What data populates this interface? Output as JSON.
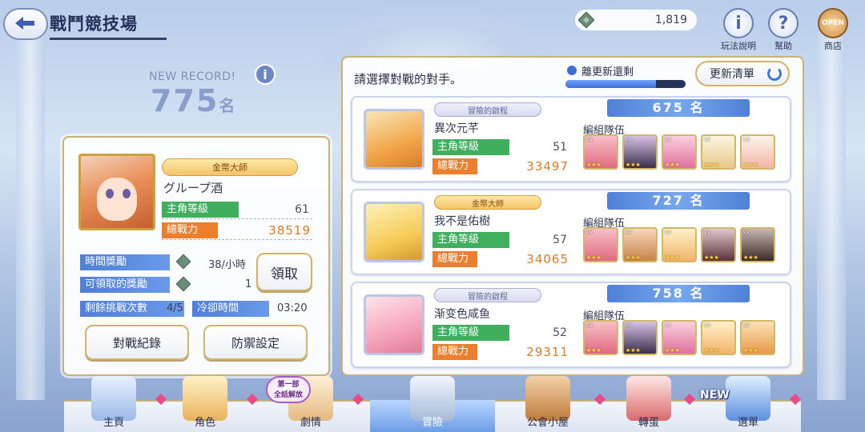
{
  "header": {
    "title": "戰鬥競技場"
  },
  "currency": {
    "amount": "1,819"
  },
  "top_buttons": [
    {
      "label": "玩法說明",
      "glyph": "i"
    },
    {
      "label": "幫助",
      "glyph": "?"
    },
    {
      "label": "商店",
      "glyph": "OPEN"
    }
  ],
  "record": {
    "label": "NEW RECORD!",
    "rank": "775",
    "unit": "名",
    "info_glyph": "i"
  },
  "player": {
    "badge": "金幣大師",
    "name": "グループ酒",
    "level_label": "主角等級",
    "level": "61",
    "power_label": "總戰力",
    "power": "38519"
  },
  "rewards": {
    "hourly_label": "時間獎勵",
    "hourly_value": "38/小時",
    "claimable_label": "可領取的獎勵",
    "claimable_value": "1",
    "claim_button": "領取",
    "remaining_label": "剩餘挑戰次數",
    "remaining_value": "4/5",
    "cooldown_label": "冷卻時間",
    "cooldown_value": "03:20"
  },
  "buttons": {
    "history": "對戰紀錄",
    "defense": "防禦設定"
  },
  "opponents_panel": {
    "title": "請選擇對戰的對手。",
    "timer_label": "離更新還剩",
    "timer_fraction": 0.75,
    "refresh_label": "更新清單"
  },
  "opponents": [
    {
      "rank": "675 名",
      "badge": "冒險的啟程",
      "name": "異次元芊",
      "level_label": "主角等級",
      "level": "51",
      "power_label": "總戰力",
      "power": "33497",
      "team_label": "編組隊伍"
    },
    {
      "rank": "727 名",
      "badge": "金幣大師",
      "name": "我不是佑樹",
      "level_label": "主角等級",
      "level": "57",
      "power_label": "總戰力",
      "power": "34065",
      "team_label": "編組隊伍"
    },
    {
      "rank": "758 名",
      "badge": "冒險的啟程",
      "name": "渐变色咸鱼",
      "level_label": "主角等級",
      "level": "52",
      "power_label": "總戰力",
      "power": "29311",
      "team_label": "編組隊伍"
    }
  ],
  "nav": {
    "items": [
      {
        "label": "主頁"
      },
      {
        "label": "角色"
      },
      {
        "label": "劇情"
      },
      {
        "label": "冒險"
      },
      {
        "label": "公會小屋"
      },
      {
        "label": "轉蛋"
      },
      {
        "label": "選單"
      }
    ],
    "new_tag": "NEW",
    "episode_badge": "第一部\n全話解放"
  },
  "colors": {
    "accent_blue": "#4f80d6",
    "level_green": "#3fae5d",
    "power_orange": "#ec7f2d",
    "frame_gold": "#c7b27a"
  }
}
